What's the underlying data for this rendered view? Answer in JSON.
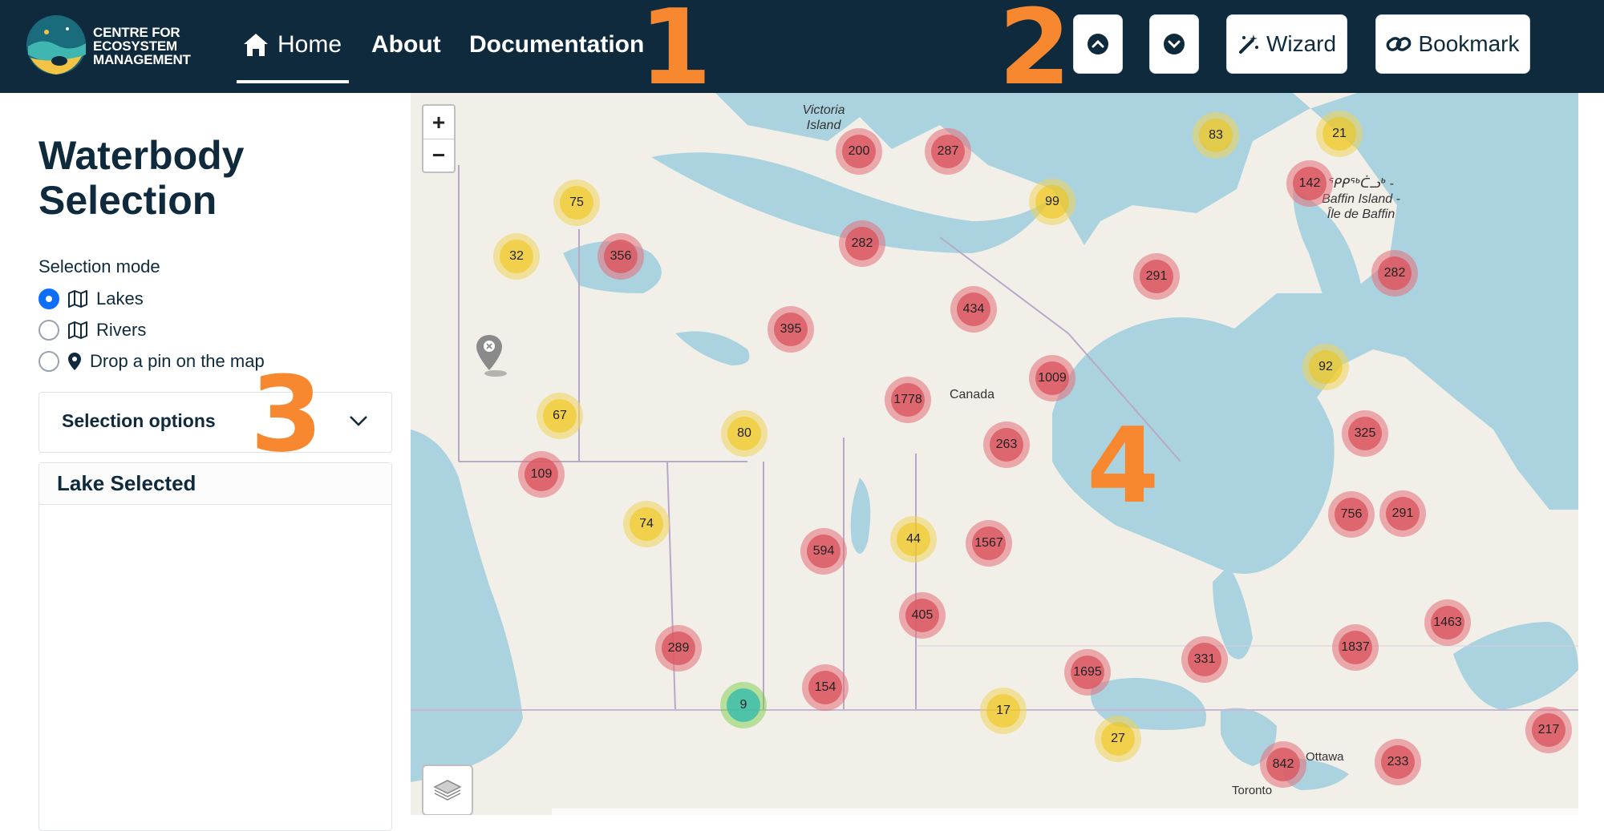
{
  "brand": {
    "line1": "CENTRE FOR",
    "line2": "ECOSYSTEM",
    "line3": "MANAGEMENT"
  },
  "nav": {
    "home": "Home",
    "about": "About",
    "documentation": "Documentation"
  },
  "annotations": [
    "1",
    "2",
    "3",
    "4"
  ],
  "toolbar": {
    "wizard": "Wizard",
    "bookmark": "Bookmark"
  },
  "sidebar": {
    "title": "Waterbody Selection",
    "mode_label": "Selection mode",
    "modes": [
      "Lakes",
      "Rivers",
      "Drop a pin on the map"
    ],
    "selected_mode": "Lakes",
    "options_label": "Selection options",
    "card_title": "Lake Selected"
  },
  "map": {
    "zoom_in": "+",
    "zoom_out": "−",
    "labels": {
      "victoria": "Victoria Island",
      "baffin": "ᕿᑭᖅᑖᓗᒃ - Baffin Island - Île de Baffin",
      "canada": "Canada",
      "ottawa": "Ottawa",
      "toronto": "Toronto"
    },
    "clusters": [
      {
        "count": "200",
        "color": "red"
      },
      {
        "count": "287",
        "color": "red"
      },
      {
        "count": "83",
        "color": "yellow"
      },
      {
        "count": "21",
        "color": "yellow"
      },
      {
        "count": "142",
        "color": "red"
      },
      {
        "count": "75",
        "color": "yellow"
      },
      {
        "count": "99",
        "color": "yellow"
      },
      {
        "count": "32",
        "color": "yellow"
      },
      {
        "count": "356",
        "color": "red"
      },
      {
        "count": "282",
        "color": "red"
      },
      {
        "count": "291",
        "color": "red"
      },
      {
        "count": "282",
        "color": "red"
      },
      {
        "count": "434",
        "color": "red"
      },
      {
        "count": "395",
        "color": "red"
      },
      {
        "count": "92",
        "color": "yellow"
      },
      {
        "count": "1009",
        "color": "red"
      },
      {
        "count": "1778",
        "color": "red"
      },
      {
        "count": "67",
        "color": "yellow"
      },
      {
        "count": "80",
        "color": "yellow"
      },
      {
        "count": "325",
        "color": "red"
      },
      {
        "count": "263",
        "color": "red"
      },
      {
        "count": "109",
        "color": "red"
      },
      {
        "count": "756",
        "color": "red"
      },
      {
        "count": "291",
        "color": "red"
      },
      {
        "count": "74",
        "color": "yellow"
      },
      {
        "count": "44",
        "color": "yellow"
      },
      {
        "count": "594",
        "color": "red"
      },
      {
        "count": "1567",
        "color": "red"
      },
      {
        "count": "405",
        "color": "red"
      },
      {
        "count": "1463",
        "color": "red"
      },
      {
        "count": "289",
        "color": "red"
      },
      {
        "count": "331",
        "color": "red"
      },
      {
        "count": "1837",
        "color": "red"
      },
      {
        "count": "1695",
        "color": "red"
      },
      {
        "count": "154",
        "color": "red"
      },
      {
        "count": "9",
        "color": "green"
      },
      {
        "count": "17",
        "color": "yellow"
      },
      {
        "count": "217",
        "color": "red"
      },
      {
        "count": "27",
        "color": "yellow"
      },
      {
        "count": "842",
        "color": "red"
      },
      {
        "count": "233",
        "color": "red"
      }
    ]
  }
}
